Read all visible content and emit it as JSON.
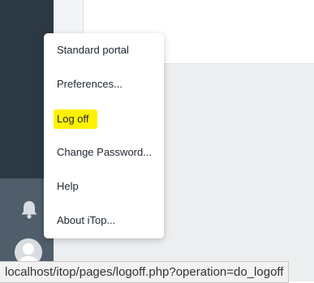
{
  "menu": {
    "items": [
      {
        "label": "Standard portal"
      },
      {
        "label": "Preferences..."
      },
      {
        "label": "Log off",
        "highlighted": true
      },
      {
        "label": "Change Password..."
      },
      {
        "label": "Help"
      },
      {
        "label": "About iTop..."
      }
    ],
    "highlight_color": "#fff200"
  },
  "sidebar": {
    "icons": [
      "bell-icon",
      "user-avatar-icon"
    ],
    "color_top": "#2c3842",
    "color_bottom": "#505d6a"
  },
  "statusbar": {
    "url": "localhost/itop/pages/logoff.php?operation=do_logoff"
  }
}
